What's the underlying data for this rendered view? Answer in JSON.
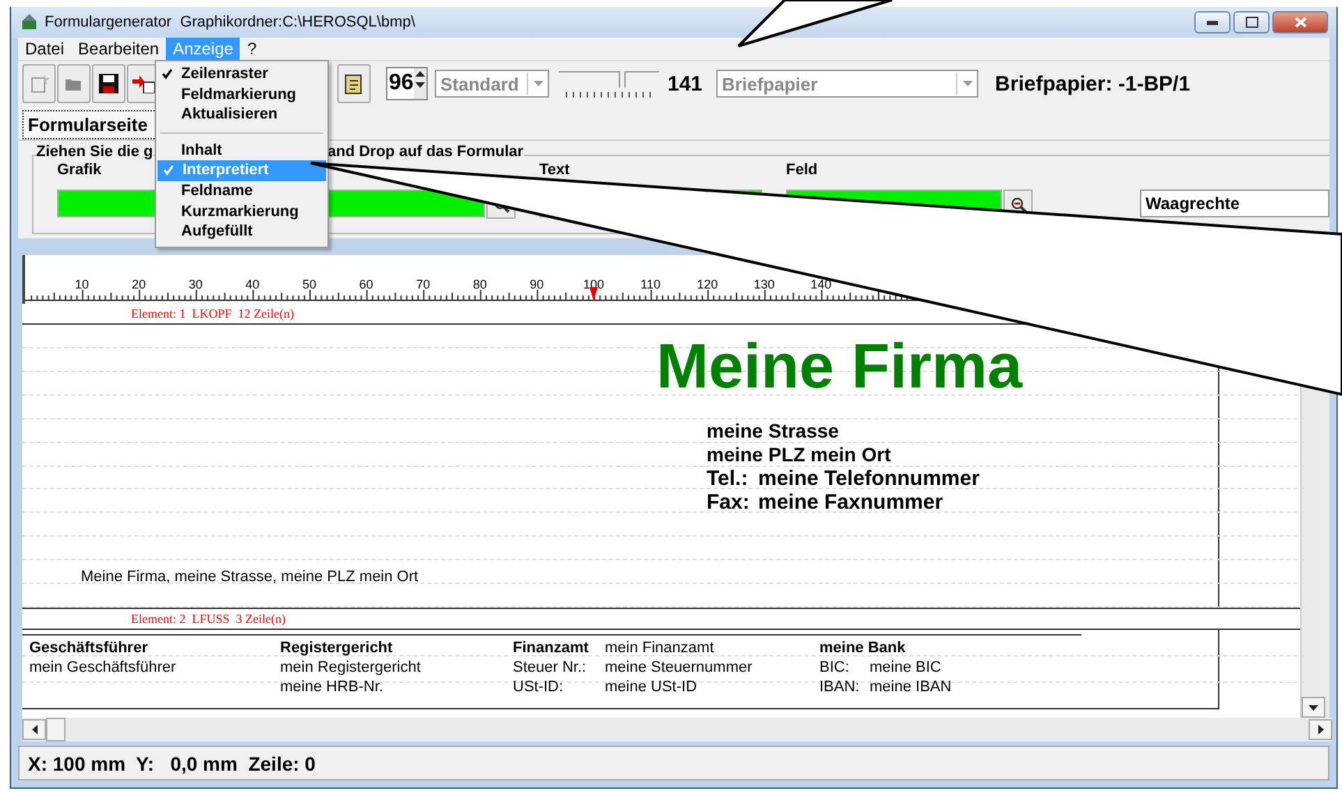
{
  "window": {
    "title": "Formulargenerator  Graphikordner:C:\\HEROSQL\\bmp\\"
  },
  "menu_bar": [
    {
      "label": "Datei",
      "selected": false
    },
    {
      "label": "Bearbeiten",
      "selected": false
    },
    {
      "label": "Anzeige",
      "selected": true
    },
    {
      "label": "?",
      "selected": false
    }
  ],
  "open_menu": {
    "groups": [
      [
        {
          "label": "Zeilenraster",
          "checked": true,
          "selected": false
        },
        {
          "label": "Feldmarkierung",
          "checked": false,
          "selected": false
        },
        {
          "label": "Aktualisieren",
          "checked": false,
          "selected": false
        }
      ],
      [
        {
          "label": "Inhalt",
          "checked": false,
          "selected": false
        },
        {
          "label": "Interpretiert",
          "checked": true,
          "selected": true
        },
        {
          "label": "Feldname",
          "checked": false,
          "selected": false
        },
        {
          "label": "Kurzmarkierung",
          "checked": false,
          "selected": false
        },
        {
          "label": "Aufgefüllt",
          "checked": false,
          "selected": false
        }
      ]
    ]
  },
  "toolbar": {
    "zoom": "96",
    "font_combo": {
      "value": "Standard",
      "disabled": true
    },
    "slider": {
      "level": 0.6
    },
    "page_count": "141",
    "paper_combo": {
      "value": "Briefpapier",
      "disabled": true
    },
    "paper_label": "Briefpapier: -1-BP/1"
  },
  "tabs": [
    {
      "label": "Formularseite",
      "selected": true
    }
  ],
  "palette": {
    "legend_start": "Ziehen Sie die g",
    "legend_end": "and Drop auf das Formular",
    "grafik_label": "Grafik",
    "text_label": "Text",
    "feld_label": "Feld",
    "orientation": "Waagrechte"
  },
  "ruler": {
    "labels": [
      "10",
      "20",
      "30",
      "40",
      "50",
      "60",
      "70",
      "80",
      "90",
      "100",
      "110",
      "120",
      "130",
      "140"
    ],
    "level": 0.443
  },
  "document": {
    "header": {
      "label": "Element: 1  LKOPF  12 Zeile(n)",
      "company": "Meine Firma",
      "address": [
        {
          "text": "meine Strasse"
        },
        {
          "text": "meine PLZ mein Ort"
        },
        {
          "label": "Tel.:",
          "text": "meine Telefonnummer"
        },
        {
          "label": "Fax:",
          "text": "meine Faxnummer"
        }
      ],
      "sender_line": "Meine Firma, meine Strasse, meine PLZ mein Ort"
    },
    "footer": {
      "label": "Element: 2  LFUSS  3 Zeile(n)",
      "blocks": [
        {
          "heading": "Geschäftsführer",
          "lines": [
            {
              "value": "mein Geschäftsführer"
            }
          ]
        },
        {
          "heading": "Registergericht",
          "lines": [
            {
              "value": "mein Registergericht"
            },
            {
              "value": "meine HRB-Nr."
            }
          ]
        },
        {
          "heading": "Finanzamt",
          "heading_value": "mein Finanzamt",
          "lines": [
            {
              "label": "Steuer Nr.:",
              "value": "meine Steuernummer"
            },
            {
              "label": "USt-ID:",
              "value": "meine USt-ID"
            }
          ]
        },
        {
          "heading": "meine Bank",
          "lines": [
            {
              "label": "BIC:",
              "value": "meine BIC"
            },
            {
              "label": "IBAN:",
              "value": "meine IBAN"
            }
          ]
        }
      ]
    }
  },
  "status_bar": "X: 100 mm  Y:   0,0 mm  Zeile: 0"
}
